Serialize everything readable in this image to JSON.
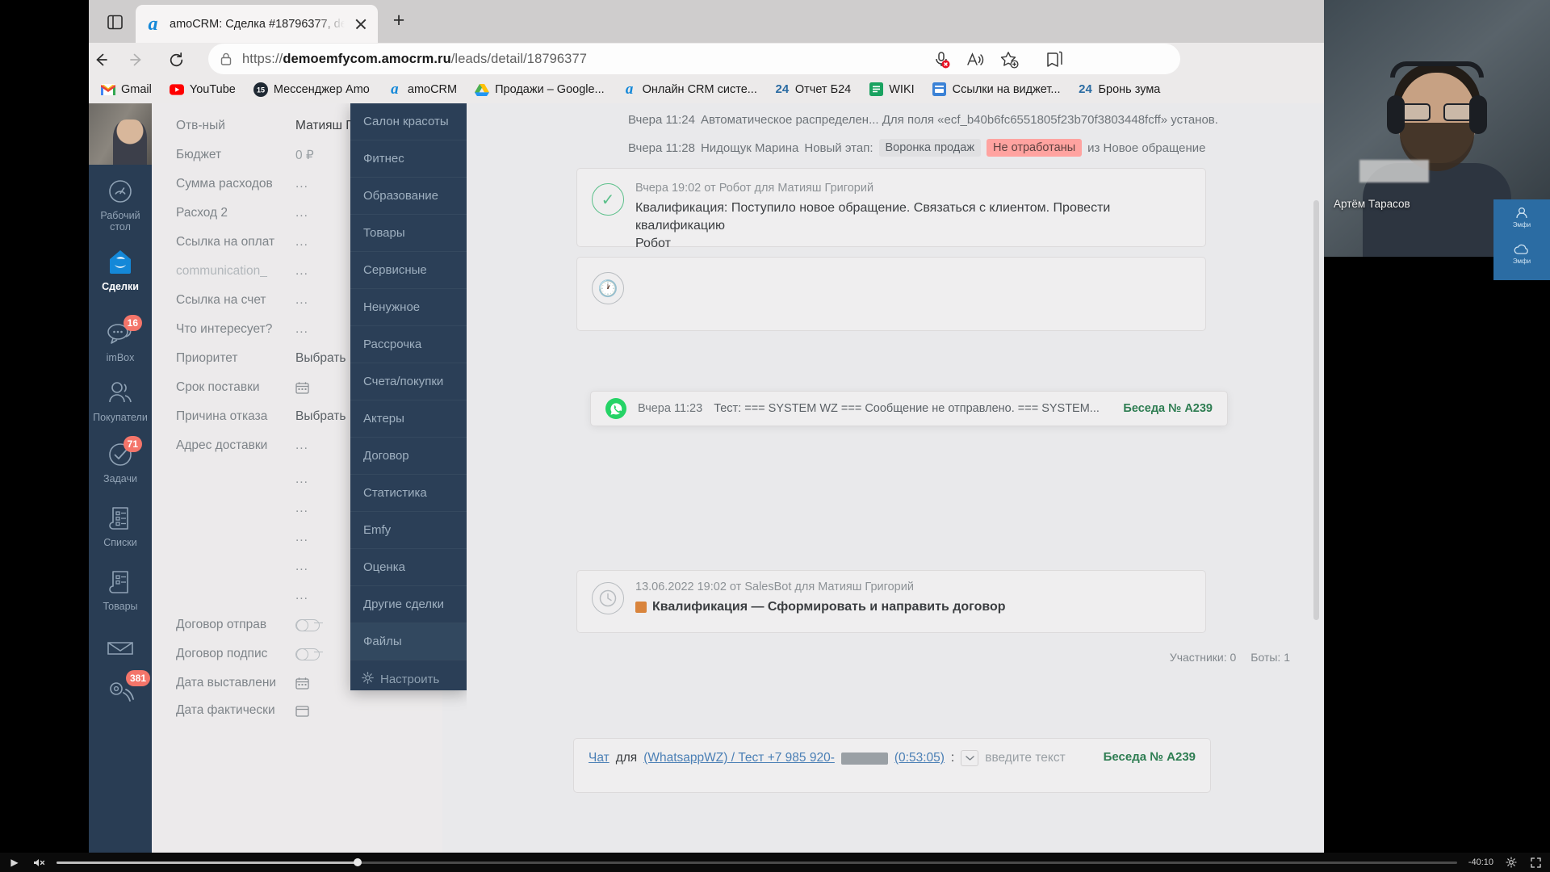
{
  "browser": {
    "tab": {
      "title": "amoCRM: Сделка #18796377, de",
      "favicon": "amo-icon",
      "close": "close-icon"
    },
    "new_tab": "+",
    "nav": {
      "back": "back-arrow-icon",
      "forward": "forward-arrow-icon",
      "reload": "reload-icon"
    },
    "url_prefix": "https://",
    "url_domain": "demoemfycom.amocrm.ru",
    "url_path": "/leads/detail/18796377",
    "toolbar_icons": [
      "microphone-muted-icon",
      "read-aloud-icon",
      "add-favorite-icon",
      "collections-icon"
    ],
    "bookmarks": [
      {
        "label": "Gmail",
        "icon": "gmail-icon"
      },
      {
        "label": "YouTube",
        "icon": "youtube-icon"
      },
      {
        "label": "Мессенджер Amo",
        "icon": "messenger-amo-icon"
      },
      {
        "label": "amoCRM",
        "icon": "amo-icon"
      },
      {
        "label": "Продажи – Google...",
        "icon": "google-drive-icon"
      },
      {
        "label": "Онлайн CRM систе...",
        "icon": "amo-icon"
      },
      {
        "label": "Отчет Б24",
        "icon": "bitrix24-icon"
      },
      {
        "label": "WIKI",
        "icon": "wiki-icon"
      },
      {
        "label": "Ссылки на виджет...",
        "icon": "bookmark-blue-icon"
      },
      {
        "label": "Бронь зума",
        "icon": "bitrix24-icon"
      }
    ]
  },
  "sidebar": {
    "items": [
      {
        "label": "Рабочий стол",
        "icon": "dashboard-icon",
        "badge": "",
        "active": false
      },
      {
        "label": "Сделки",
        "icon": "leads-icon",
        "badge": "",
        "active": true
      },
      {
        "label": "imBox",
        "icon": "chat-bubbles-icon",
        "badge": "16",
        "active": false
      },
      {
        "label": "Покупатели",
        "icon": "customers-icon",
        "badge": "",
        "active": false
      },
      {
        "label": "Задачи",
        "icon": "tasks-check-icon",
        "badge": "71",
        "active": false
      },
      {
        "label": "Списки",
        "icon": "lists-icon",
        "badge": "",
        "active": false
      },
      {
        "label": "Товары",
        "icon": "products-icon",
        "badge": "",
        "active": false
      },
      {
        "label": "",
        "icon": "mail-icon",
        "badge": "",
        "active": false
      },
      {
        "label": "",
        "icon": "phone-icon",
        "badge": "381",
        "active": false
      }
    ]
  },
  "card_fields": [
    {
      "label": "Отв-ный",
      "value": "Матияш Григор",
      "type": "text"
    },
    {
      "label": "Бюджет",
      "value": "0 ₽",
      "type": "money"
    },
    {
      "label": "Сумма расходов",
      "value": "...",
      "type": "dots"
    },
    {
      "label": "Расход 2",
      "value": "...",
      "type": "dots"
    },
    {
      "label": "Ссылка на оплат",
      "value": "...",
      "type": "dots"
    },
    {
      "label": "communication_",
      "value": "...",
      "type": "dots",
      "faded": true
    },
    {
      "label": "Ссылка на счет",
      "value": "...",
      "type": "dots"
    },
    {
      "label": "Что интересует?",
      "value": "...",
      "type": "dots"
    },
    {
      "label": "Приоритет",
      "value": "Выбрать",
      "type": "select"
    },
    {
      "label": "Срок поставки",
      "value": "",
      "type": "date"
    },
    {
      "label": "Причина отказа",
      "value": "Выбрать",
      "type": "select"
    },
    {
      "label": "Адрес доставки",
      "value": "...",
      "type": "dots"
    },
    {
      "label": "",
      "value": "...",
      "type": "dots"
    },
    {
      "label": "",
      "value": "...",
      "type": "dots"
    },
    {
      "label": "",
      "value": "...",
      "type": "dots"
    },
    {
      "label": "",
      "value": "...",
      "type": "dots"
    },
    {
      "label": "",
      "value": "...",
      "type": "dots"
    },
    {
      "label": "Договор отправ",
      "value": "",
      "type": "toggle"
    },
    {
      "label": "Договор подпис",
      "value": "",
      "type": "toggle"
    },
    {
      "label": "Дата выставлени",
      "value": "",
      "type": "date"
    },
    {
      "label": "Дата фактически",
      "value": "",
      "type": "date"
    }
  ],
  "dropdown": {
    "items": [
      {
        "label": "Салон красоты",
        "hover": false
      },
      {
        "label": "Фитнес",
        "hover": false
      },
      {
        "label": "Образование",
        "hover": false
      },
      {
        "label": "Товары",
        "hover": false
      },
      {
        "label": "Сервисные",
        "hover": false
      },
      {
        "label": "Ненужное",
        "hover": false
      },
      {
        "label": "Рассрочка",
        "hover": false
      },
      {
        "label": "Счета/покупки",
        "hover": false
      },
      {
        "label": "Актеры",
        "hover": false
      },
      {
        "label": "Договор",
        "hover": false
      },
      {
        "label": "Статистика",
        "hover": false
      },
      {
        "label": "Emfy",
        "hover": false
      },
      {
        "label": "Оценка",
        "hover": false
      },
      {
        "label": "Другие сделки",
        "hover": false
      },
      {
        "label": "Файлы",
        "hover": true
      }
    ],
    "settings": {
      "label": "Настроить",
      "icon": "gear-icon"
    }
  },
  "feed": {
    "events": [
      {
        "time": "Вчера 11:24",
        "text": "Автоматическое распределен... Для поля «ecf_b40b6fc6551805f23b70f3803448fcff» установ."
      }
    ],
    "stage_event": {
      "time": "Вчера 11:28",
      "author": "Нидощук Марина",
      "action": "Новый этап:",
      "pipeline": "Воронка продаж",
      "stage": "Не отработаны",
      "from_label": "из Новое обращение"
    },
    "notes": [
      {
        "icon": "check-circle-green-icon",
        "meta": "Вчера 19:02  от Робот для Матияш Григорий",
        "body": "Квалификация: Поступило новое обращение. Связаться с клиентом. Провести квалификацию",
        "body2": "Робот"
      },
      {
        "icon": "clock-circle-icon",
        "meta": "13.06.2022 19:02 от SalesBot для Матияш Григорий",
        "body": "Квалификация — Сформировать и направить договор",
        "body2": ""
      }
    ],
    "whatsapp_toast": {
      "icon": "whatsapp-icon",
      "time": "Вчера 11:23",
      "text": "Тест: === SYSTEM WZ === Сообщение не отправлено. === SYSTEM...",
      "conversation": "Беседа № A239"
    },
    "participants": {
      "people": "Участники: 0",
      "bots": "Боты: 1"
    }
  },
  "composer": {
    "prefix": "Чат",
    "for_label": "для",
    "channel": "(WhatsappWZ) / Тест +7 985 920-",
    "duration": "(0:53:05)",
    "colon": ":",
    "placeholder": "введите текст",
    "conversation": "Беседа № A239",
    "caret_icon": "chevron-down-icon"
  },
  "webcam": {
    "name": "Артём Тарасов",
    "widget_labels": [
      "Эмфи",
      "Эмфи"
    ]
  },
  "player": {
    "play_icon": "play-icon",
    "mute_icon": "volume-muted-icon",
    "time_remaining": "-40:10",
    "fullscreen_icon": "fullscreen-icon",
    "settings_icon": "gear-icon",
    "progress_percent": 21.5
  },
  "colors": {
    "accent_blue": "#1488d8",
    "sidebar_dark": "#293d54",
    "dropdown_dark": "#2b3f57",
    "badge_red": "#f4756a",
    "stage_red": "#ffa3a0",
    "green": "#5cc08b",
    "whatsapp_green": "#25d366",
    "conversation_green": "#2e7d52"
  }
}
